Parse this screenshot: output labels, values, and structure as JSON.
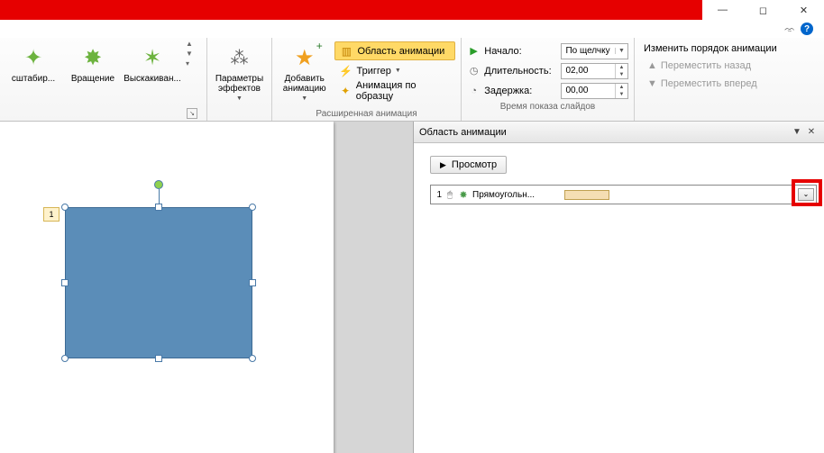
{
  "ribbon": {
    "effects": {
      "items": [
        "сштабир...",
        "Вращение",
        "Выскакиван..."
      ]
    },
    "effect_options": "Параметры эффектов",
    "add_animation": "Добавить анимацию",
    "ext": {
      "pane": "Область анимации",
      "trigger": "Триггер",
      "painter": "Анимация по образцу",
      "group_label": "Расширенная анимация"
    },
    "timing": {
      "start_label": "Начало:",
      "start_value": "По щелчку",
      "duration_label": "Длительность:",
      "duration_value": "02,00",
      "delay_label": "Задержка:",
      "delay_value": "00,00",
      "group_label": "Время показа слайдов"
    },
    "reorder": {
      "title": "Изменить порядок анимации",
      "back": "Переместить назад",
      "forward": "Переместить вперед"
    }
  },
  "slide": {
    "anim_index": "1"
  },
  "pane": {
    "title": "Область анимации",
    "preview": "Просмотр",
    "item": {
      "index": "1",
      "name": "Прямоугольн..."
    }
  }
}
